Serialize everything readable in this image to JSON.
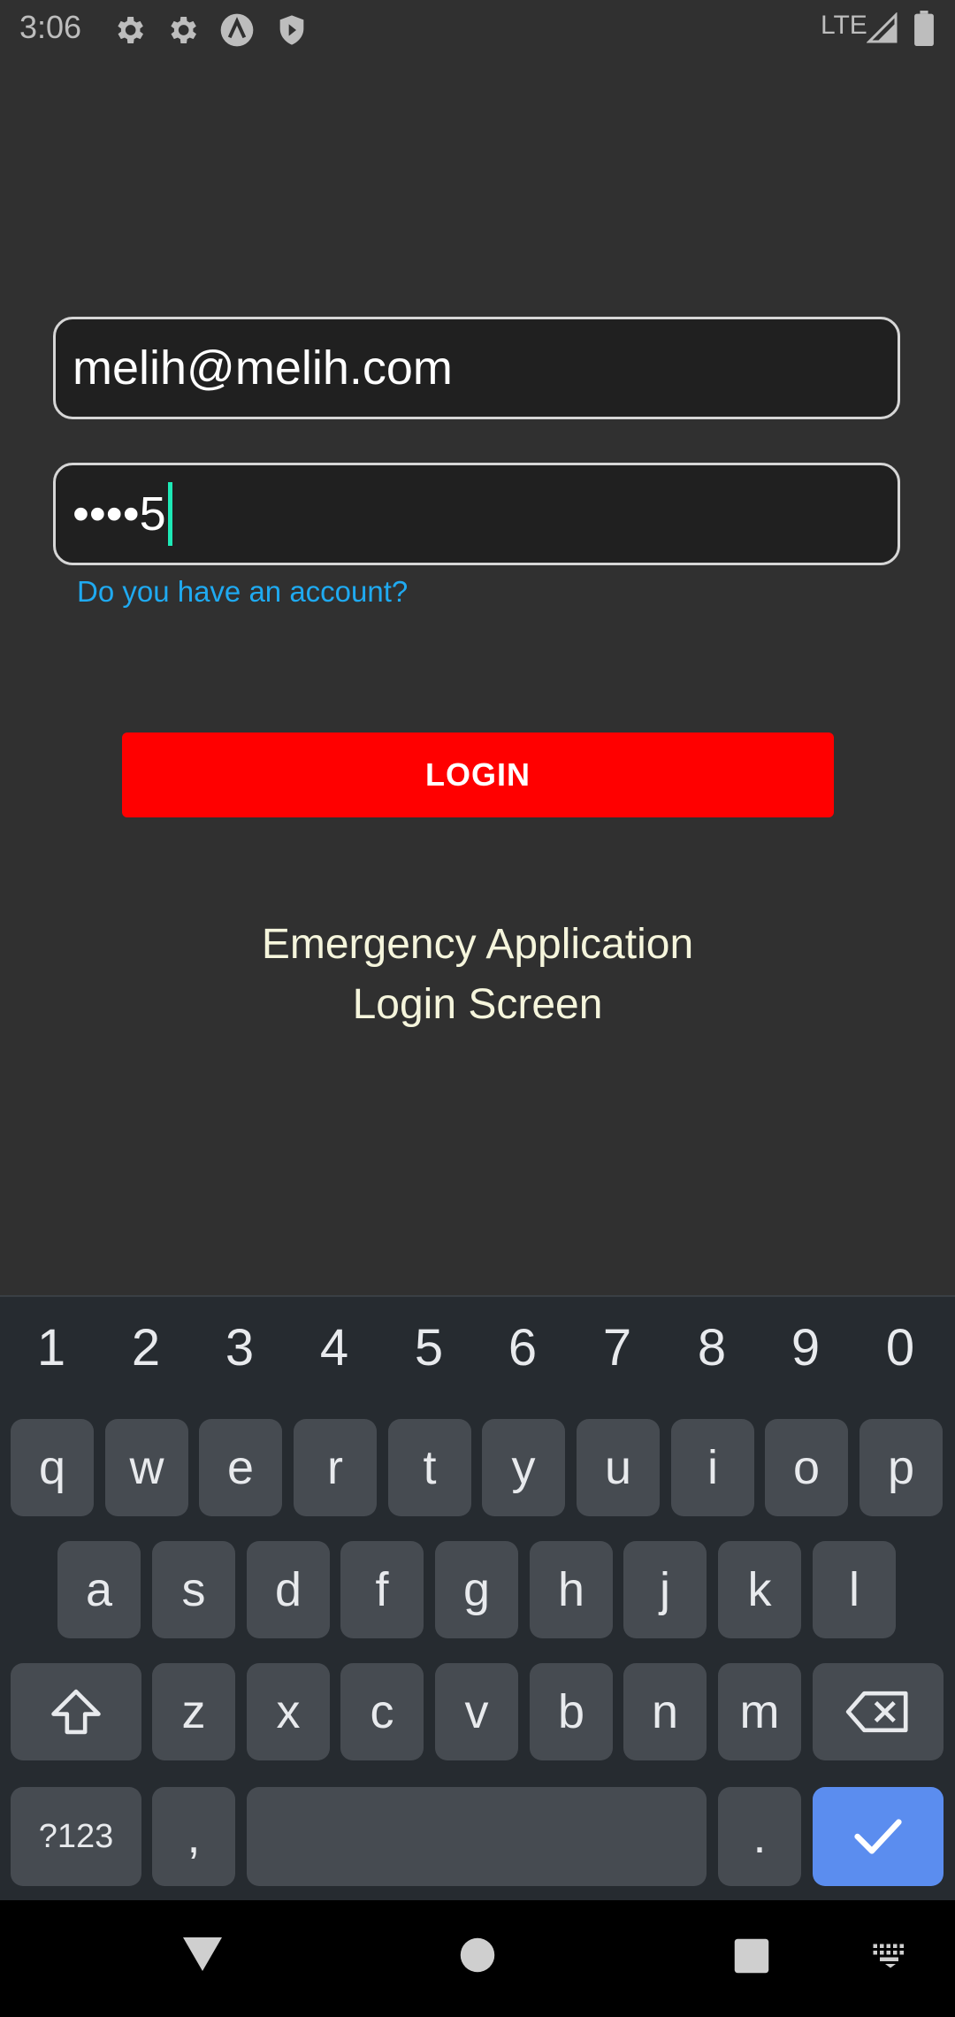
{
  "status_bar": {
    "time": "3:06",
    "network": "LTE",
    "left_icons": [
      "gear-icon",
      "gear-icon",
      "app-a-icon",
      "shield-icon"
    ]
  },
  "form": {
    "email_value": "melih@melih.com",
    "password_value": "••••5",
    "account_link": "Do you have an account?",
    "login_button": "LOGIN"
  },
  "title": {
    "line1": "Emergency Application",
    "line2": "Login Screen"
  },
  "keyboard": {
    "number_row": [
      "1",
      "2",
      "3",
      "4",
      "5",
      "6",
      "7",
      "8",
      "9",
      "0"
    ],
    "row1": [
      "q",
      "w",
      "e",
      "r",
      "t",
      "y",
      "u",
      "i",
      "o",
      "p"
    ],
    "row2": [
      "a",
      "s",
      "d",
      "f",
      "g",
      "h",
      "j",
      "k",
      "l"
    ],
    "row3": [
      "z",
      "x",
      "c",
      "v",
      "b",
      "n",
      "m"
    ],
    "symbols_key": "?123",
    "comma_key": ",",
    "period_key": "."
  },
  "colors": {
    "background": "#303030",
    "login_button": "#ff0000",
    "link": "#1faaf1",
    "title_text": "#f5f5dc",
    "cursor": "#1de9b6",
    "enter_key": "#5b8def"
  }
}
